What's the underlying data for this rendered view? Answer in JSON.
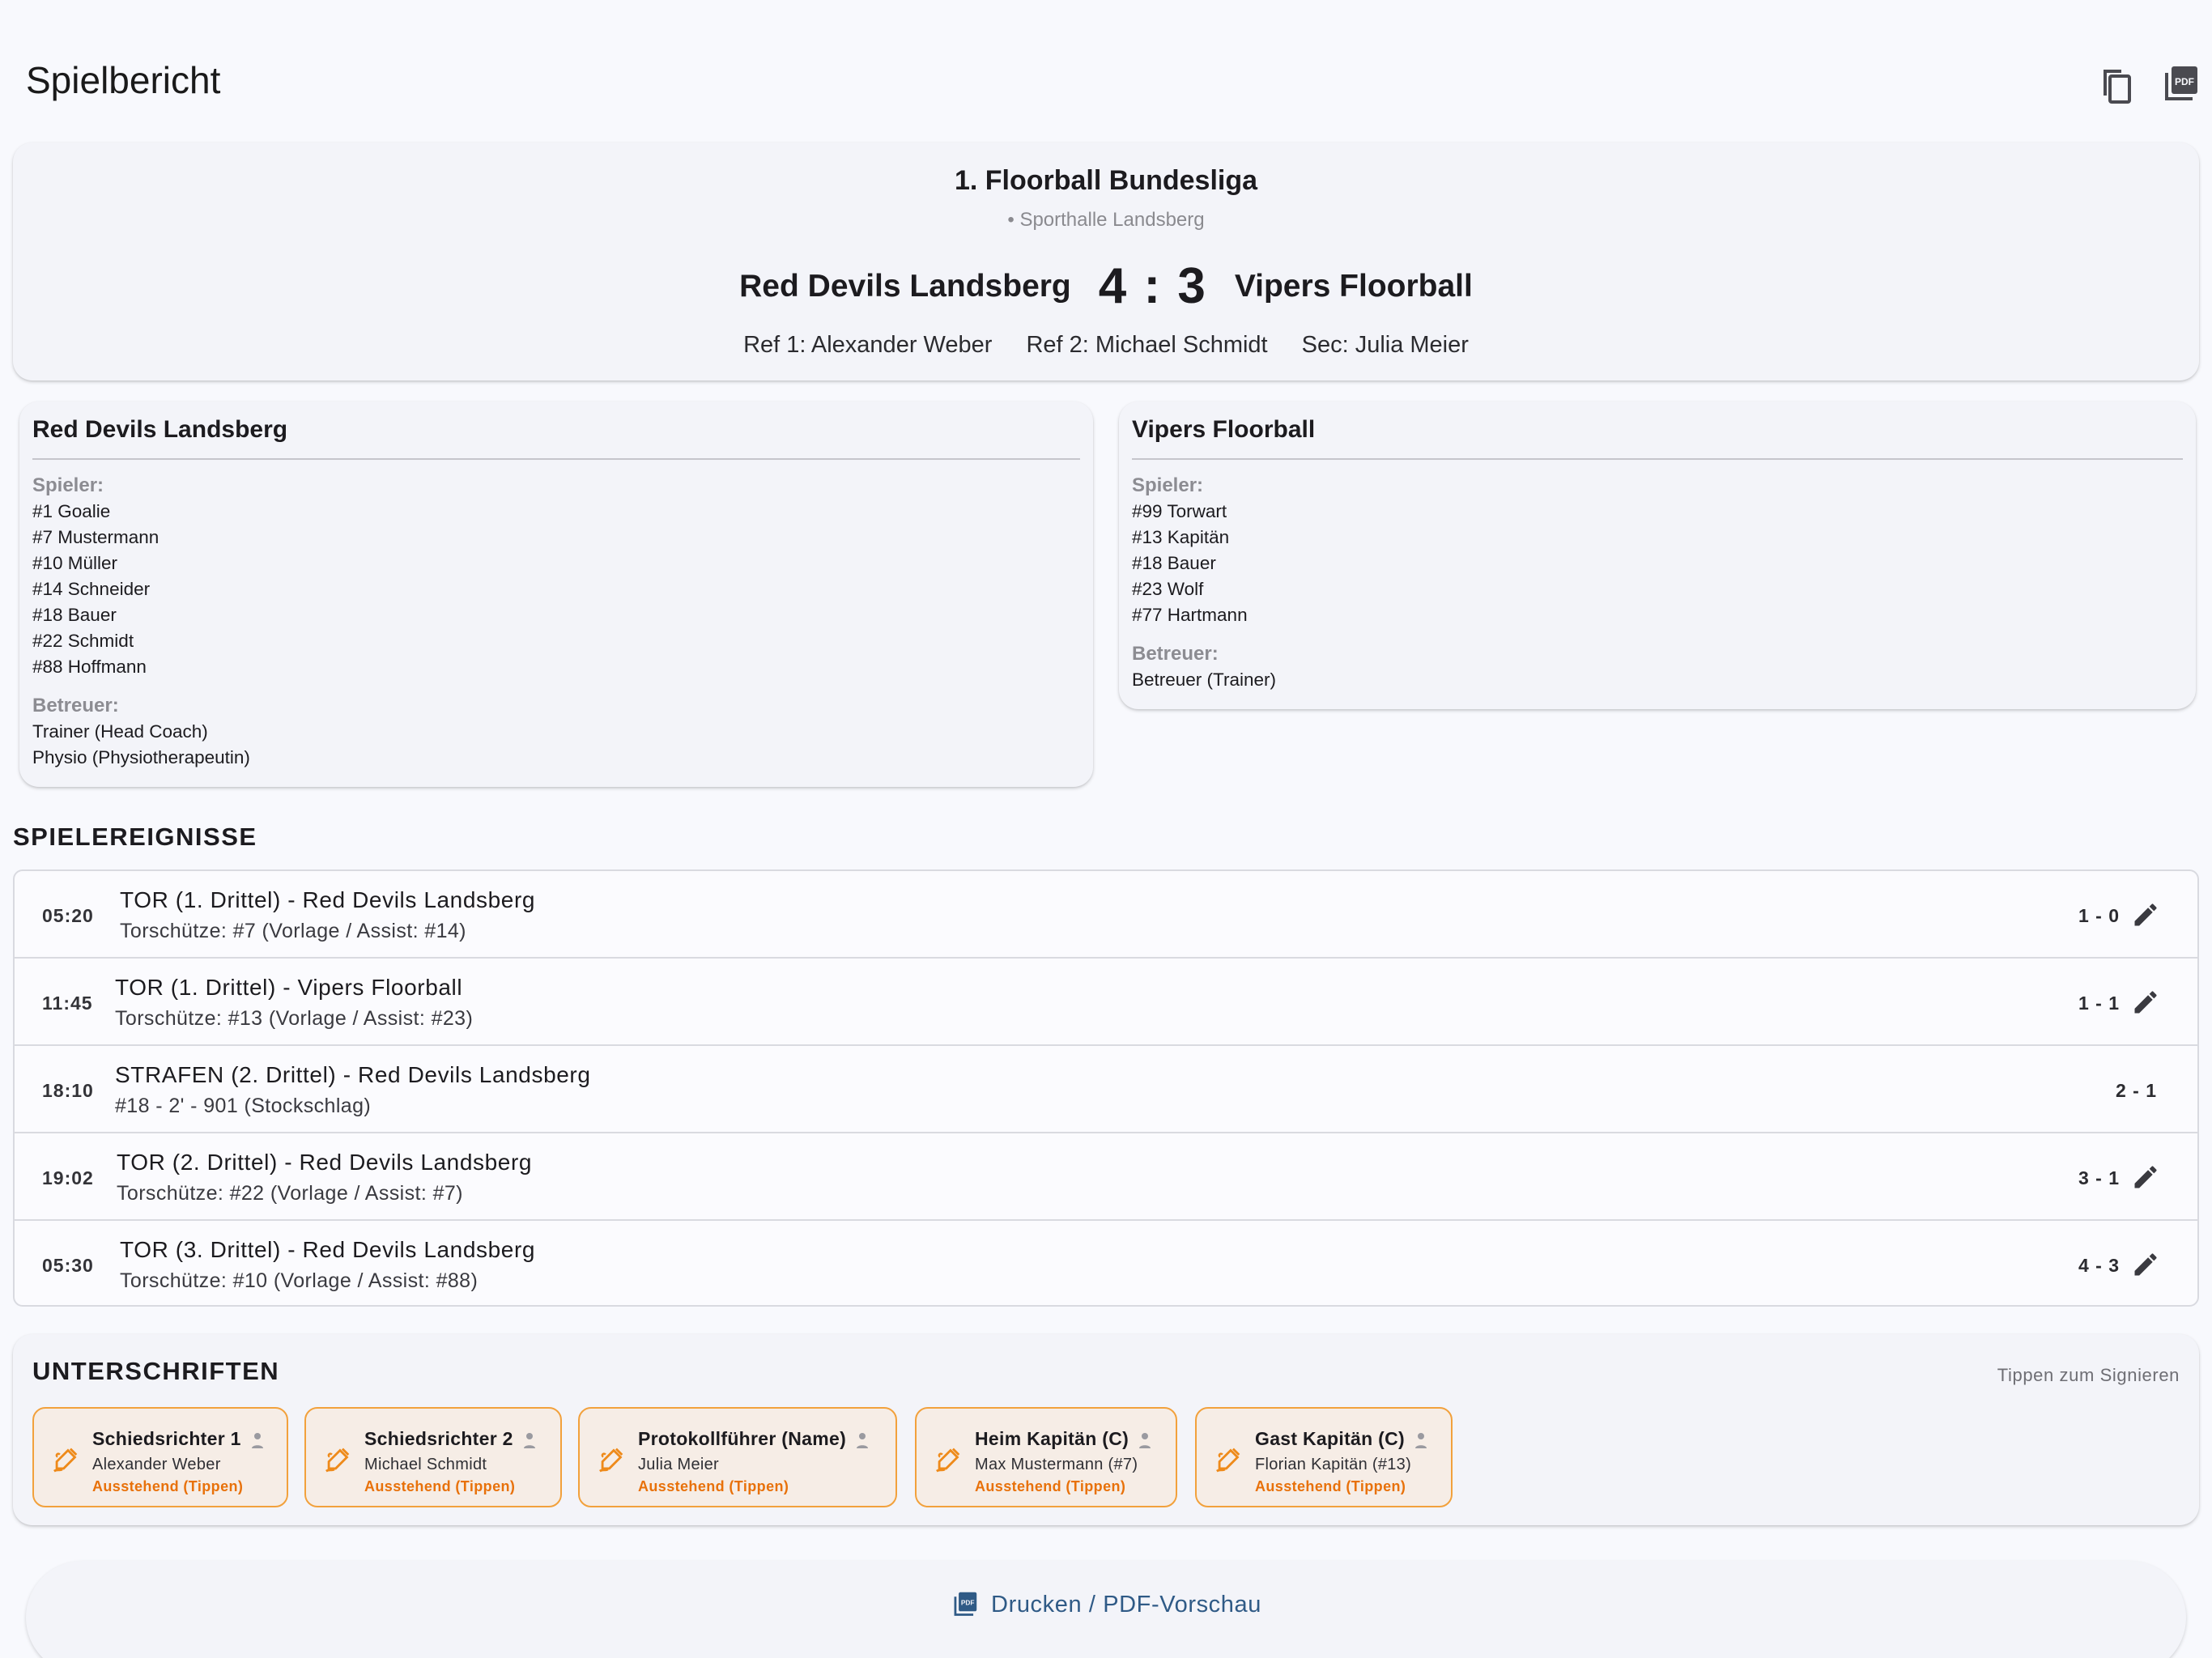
{
  "appbar": {
    "title": "Spielbericht",
    "actions": [
      {
        "icon": "copy-icon"
      },
      {
        "icon": "pdf-icon"
      }
    ]
  },
  "match": {
    "league": "1. Floorball Bundesliga",
    "venue": "• Sporthalle Landsberg",
    "home": "Red Devils Landsberg",
    "away": "Vipers Floorball",
    "score": "4 : 3",
    "ref1": "Ref 1: Alexander Weber",
    "ref2": "Ref 2: Michael Schmidt",
    "sec": "Sec: Julia Meier"
  },
  "teams": {
    "home": {
      "name": "Red Devils Landsberg",
      "players_label": "Spieler:",
      "players": [
        "#1 Goalie",
        "#7 Mustermann",
        "#10 Müller",
        "#14 Schneider",
        "#18 Bauer",
        "#22 Schmidt",
        "#88 Hoffmann"
      ],
      "staff_label": "Betreuer:",
      "staff": [
        "Trainer (Head Coach)",
        "Physio (Physiotherapeutin)"
      ]
    },
    "away": {
      "name": "Vipers Floorball",
      "players_label": "Spieler:",
      "players": [
        "#99 Torwart",
        "#13 Kapitän",
        "#18 Bauer",
        "#23 Wolf",
        "#77 Hartmann"
      ],
      "staff_label": "Betreuer:",
      "staff": [
        "Betreuer (Trainer)"
      ]
    }
  },
  "events": {
    "title": "SPIELEREIGNISSE",
    "items": [
      {
        "time": "05:20",
        "title": "TOR (1. Drittel) - Red Devils Landsberg",
        "sub": "Torschütze: #7 (Vorlage / Assist: #14)",
        "score": "1 - 0",
        "editable": true
      },
      {
        "time": "11:45",
        "title": "TOR (1. Drittel) - Vipers Floorball",
        "sub": "Torschütze: #13 (Vorlage / Assist: #23)",
        "score": "1 - 1",
        "editable": true
      },
      {
        "time": "18:10",
        "title": "STRAFEN (2. Drittel) - Red Devils Landsberg",
        "sub": "#18 - 2' - 901 (Stockschlag)",
        "score": "2 - 1",
        "editable": false
      },
      {
        "time": "19:02",
        "title": "TOR (2. Drittel) - Red Devils Landsberg",
        "sub": "Torschütze: #22 (Vorlage / Assist: #7)",
        "score": "3 - 1",
        "editable": true
      },
      {
        "time": "05:30",
        "title": "TOR (3. Drittel) - Red Devils Landsberg",
        "sub": "Torschütze: #10 (Vorlage / Assist: #88)",
        "score": "4 - 3",
        "editable": true
      }
    ]
  },
  "signatures": {
    "title": "UNTERSCHRIFTEN",
    "hint": "Tippen zum Signieren",
    "items": [
      {
        "role": "Schiedsrichter 1",
        "name": "Alexander Weber",
        "status": "Ausstehend (Tippen)"
      },
      {
        "role": "Schiedsrichter 2",
        "name": "Michael Schmidt",
        "status": "Ausstehend (Tippen)"
      },
      {
        "role": "Protokollführer (Name)",
        "name": "Julia Meier",
        "status": "Ausstehend (Tippen)"
      },
      {
        "role": "Heim Kapitän (C)",
        "name": "Max Mustermann (#7)",
        "status": "Ausstehend (Tippen)"
      },
      {
        "role": "Gast Kapitän (C)",
        "name": "Florian Kapitän (#13)",
        "status": "Ausstehend (Tippen)"
      }
    ]
  },
  "print": {
    "label": "Drucken / PDF-Vorschau"
  },
  "colors": {
    "accent": "#2f5a86",
    "pending": "#e8710a",
    "tile_border": "#f2a13c",
    "tile_bg": "#f6ede6"
  }
}
